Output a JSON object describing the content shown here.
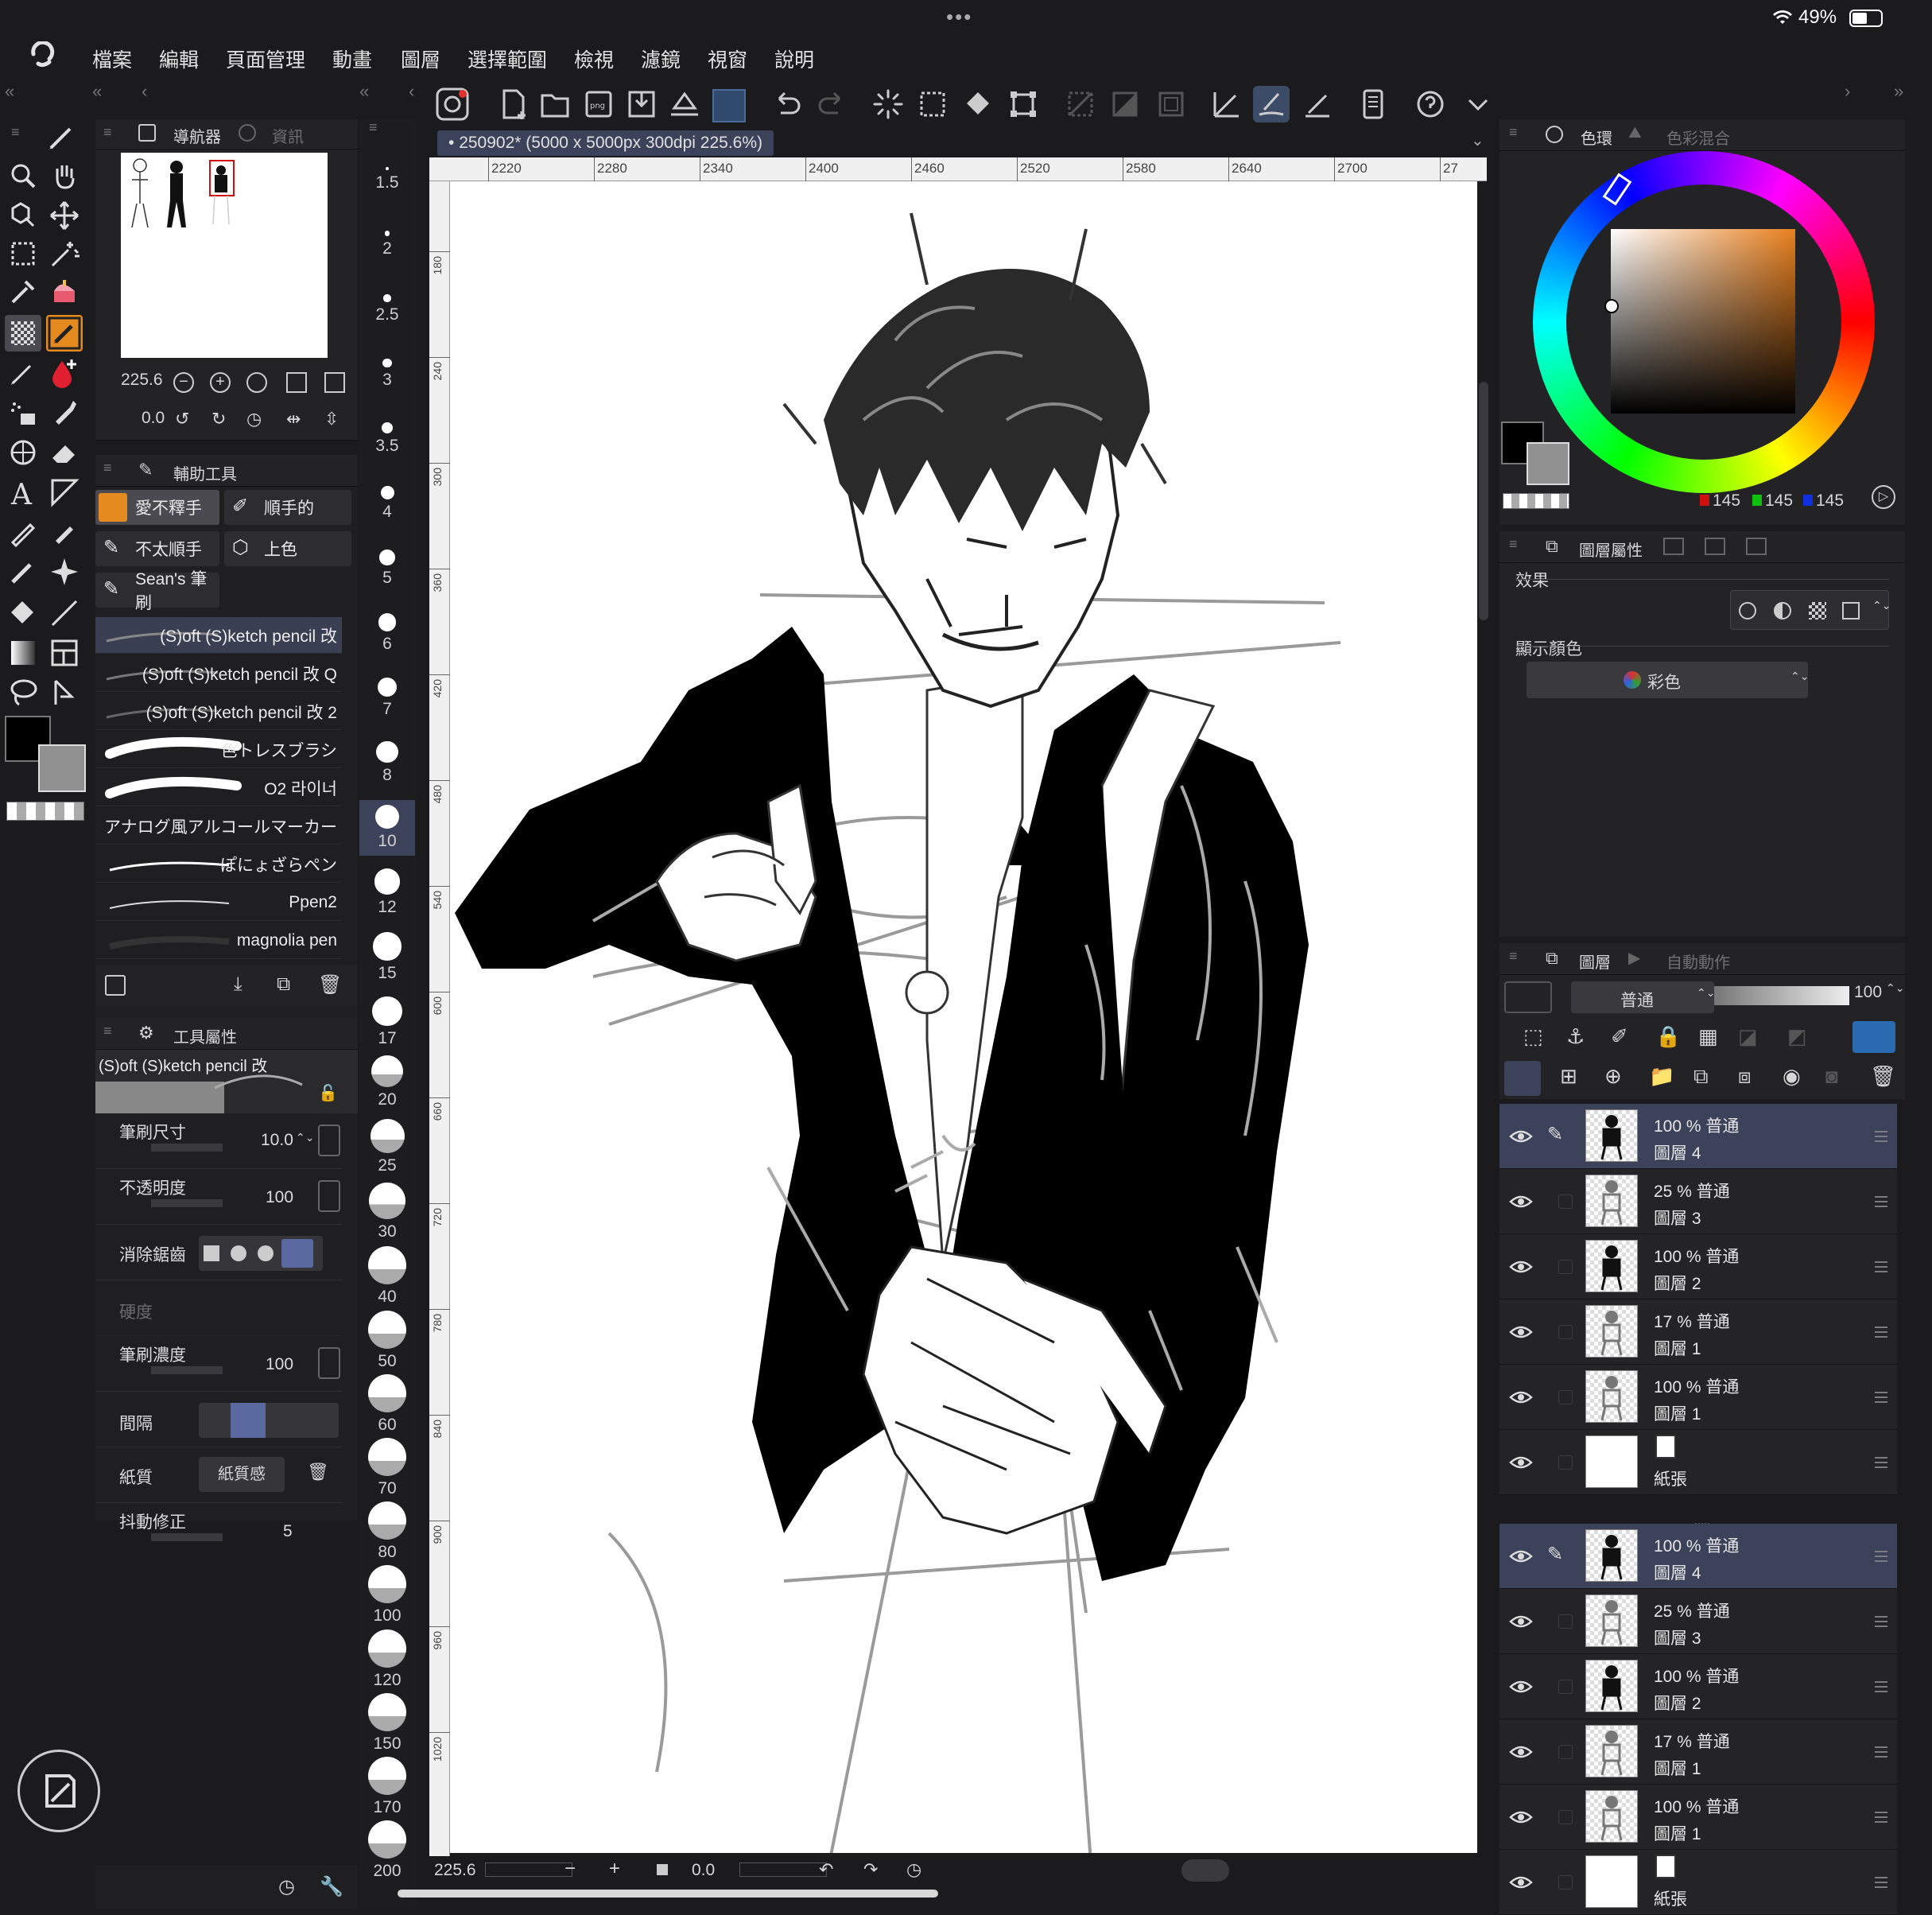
{
  "status": {
    "battery": "49%",
    "dots": "•••"
  },
  "menu": [
    "檔案",
    "編輯",
    "頁面管理",
    "動畫",
    "圖層",
    "選擇範圍",
    "檢視",
    "濾鏡",
    "視窗",
    "說明"
  ],
  "document_tab": "250902* (5000 x 5000px 300dpi 225.6%)",
  "ruler": {
    "top": [
      "2220",
      "2280",
      "2340",
      "2400",
      "2460",
      "2520",
      "2580",
      "2640",
      "2700",
      "27"
    ],
    "left": [
      "180",
      "240",
      "300",
      "360",
      "420",
      "480",
      "540",
      "600",
      "660",
      "720",
      "780",
      "840",
      "900",
      "960",
      "1020"
    ]
  },
  "navigator": {
    "tab_label": "導航器",
    "tab2_label": "資訊",
    "zoom": "225.6",
    "rotation": "0.0"
  },
  "subtool": {
    "title": "輔助工具",
    "groups": [
      "愛不釋手",
      "順手的",
      "不太順手",
      "上色",
      "Sean's 筆刷"
    ],
    "brushes": [
      "(S)oft (S)ketch pencil 改",
      "(S)oft (S)ketch pencil 改 Q",
      "(S)oft (S)ketch pencil 改 2",
      "色トレスブラシ",
      "O2 라이너",
      "アナログ風アルコールマーカー",
      "ぽにょざらペン",
      "Ppen2",
      "magnolia pen"
    ]
  },
  "tool_props": {
    "title": "工具屬性",
    "brush_name": "(S)oft (S)ketch pencil 改",
    "rows": [
      {
        "label": "筆刷尺寸",
        "value": "10.0"
      },
      {
        "label": "不透明度",
        "value": "100"
      },
      {
        "label": "消除鋸齒",
        "value": ""
      },
      {
        "label": "硬度",
        "value": ""
      },
      {
        "label": "筆刷濃度",
        "value": "100"
      },
      {
        "label": "間隔",
        "value": ""
      },
      {
        "label": "紙質",
        "value": "紙質感"
      },
      {
        "label": "抖動修正",
        "value": "5"
      }
    ]
  },
  "brush_sizes": [
    "1.5",
    "2",
    "2.5",
    "3",
    "3.5",
    "4",
    "5",
    "6",
    "7",
    "8",
    "10",
    "12",
    "15",
    "17",
    "20",
    "25",
    "30",
    "40",
    "50",
    "60",
    "70",
    "80",
    "100",
    "120",
    "150",
    "170",
    "200"
  ],
  "selected_brush_size": "10",
  "color_panel": {
    "tab_label": "色環",
    "tab2_label": "色彩混合",
    "r": "145",
    "g": "145",
    "b": "145",
    "main_color": "#000000",
    "sub_color": "#919191",
    "hue_color": "#e8801e"
  },
  "layer_property": {
    "tab_label": "圖層屬性",
    "effect_label": "效果",
    "display_color_label": "顯示顏色",
    "display_color_value": "彩色"
  },
  "layers_panel": {
    "tab_label": "圖層",
    "tab2_label": "自動動作",
    "blend_mode": "普通",
    "opacity": "100",
    "group1": [
      {
        "pct": "100 %  普通",
        "name": "圖層 4",
        "selected": true
      },
      {
        "pct": "25 %  普通",
        "name": "圖層 3",
        "selected": false
      },
      {
        "pct": "100 %  普通",
        "name": "圖層 2",
        "selected": false
      },
      {
        "pct": "17 %  普通",
        "name": "圖層 1",
        "selected": false
      },
      {
        "pct": "100 %  普通",
        "name": "圖層 1",
        "selected": false
      },
      {
        "pct": "",
        "name": "紙張",
        "selected": false
      }
    ],
    "group2": [
      {
        "pct": "100 %  普通",
        "name": "圖層 4",
        "selected": true
      },
      {
        "pct": "25 %  普通",
        "name": "圖層 3",
        "selected": false
      },
      {
        "pct": "100 %  普通",
        "name": "圖層 2",
        "selected": false
      },
      {
        "pct": "17 %  普通",
        "name": "圖層 1",
        "selected": false
      },
      {
        "pct": "100 %  普通",
        "name": "圖層 1",
        "selected": false
      },
      {
        "pct": "",
        "name": "紙張",
        "selected": false
      }
    ]
  },
  "bottom_bar": {
    "zoom": "225.6",
    "rotation": "0.0"
  },
  "accent": "#e58a1f",
  "selection_blue": "#3b4259"
}
